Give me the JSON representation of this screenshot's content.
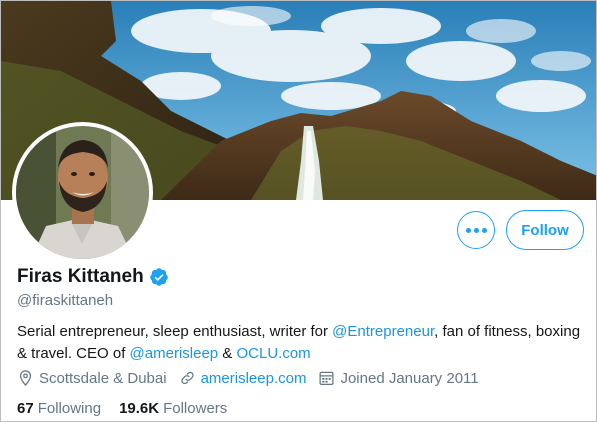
{
  "profile": {
    "name": "Firas Kittaneh",
    "handle": "@firaskittaneh",
    "verified_icon": "verified-badge-icon",
    "bio": {
      "part1": "Serial entrepreneur, sleep enthusiast, writer for ",
      "link1": "@Entrepreneur",
      "part2": ", fan of fitness, boxing & travel. CEO of ",
      "link2": "@amerisleep",
      "part3": " & ",
      "link3": "OCLU.com"
    },
    "location": "Scottsdale & Dubai",
    "website": "amerisleep.com",
    "joined": "Joined January 2011"
  },
  "actions": {
    "more_icon": "more-options-icon",
    "follow_label": "Follow"
  },
  "stats": {
    "following_count": "67",
    "following_label": "Following",
    "followers_count": "19.6K",
    "followers_label": "Followers"
  },
  "colors": {
    "accent": "#1da1f2",
    "link": "#1b95e0",
    "secondary_text": "#657786"
  }
}
